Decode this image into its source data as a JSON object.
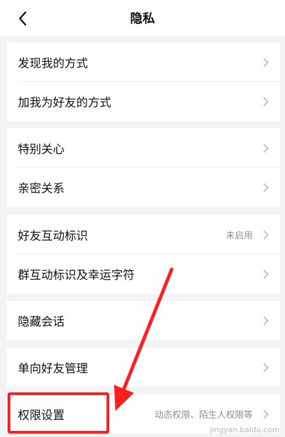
{
  "header": {
    "title": "隐私",
    "back_icon": "chevron-left-icon"
  },
  "groups": [
    {
      "items": [
        {
          "label": "发现我的方式"
        },
        {
          "label": "加我为好友的方式"
        }
      ]
    },
    {
      "items": [
        {
          "label": "特别关心"
        },
        {
          "label": "亲密关系"
        }
      ]
    },
    {
      "items": [
        {
          "label": "好友互动标识",
          "value": "未启用"
        },
        {
          "label": "群互动标识及幸运字符"
        }
      ]
    },
    {
      "items": [
        {
          "label": "隐藏会话"
        }
      ]
    },
    {
      "items": [
        {
          "label": "单向好友管理"
        }
      ]
    },
    {
      "items": [
        {
          "label": "权限设置",
          "value": "动态权限、陌生人权限等"
        }
      ]
    }
  ],
  "annotation": {
    "color": "#ff1f1f"
  },
  "watermark": "jingyan.baidu.com"
}
